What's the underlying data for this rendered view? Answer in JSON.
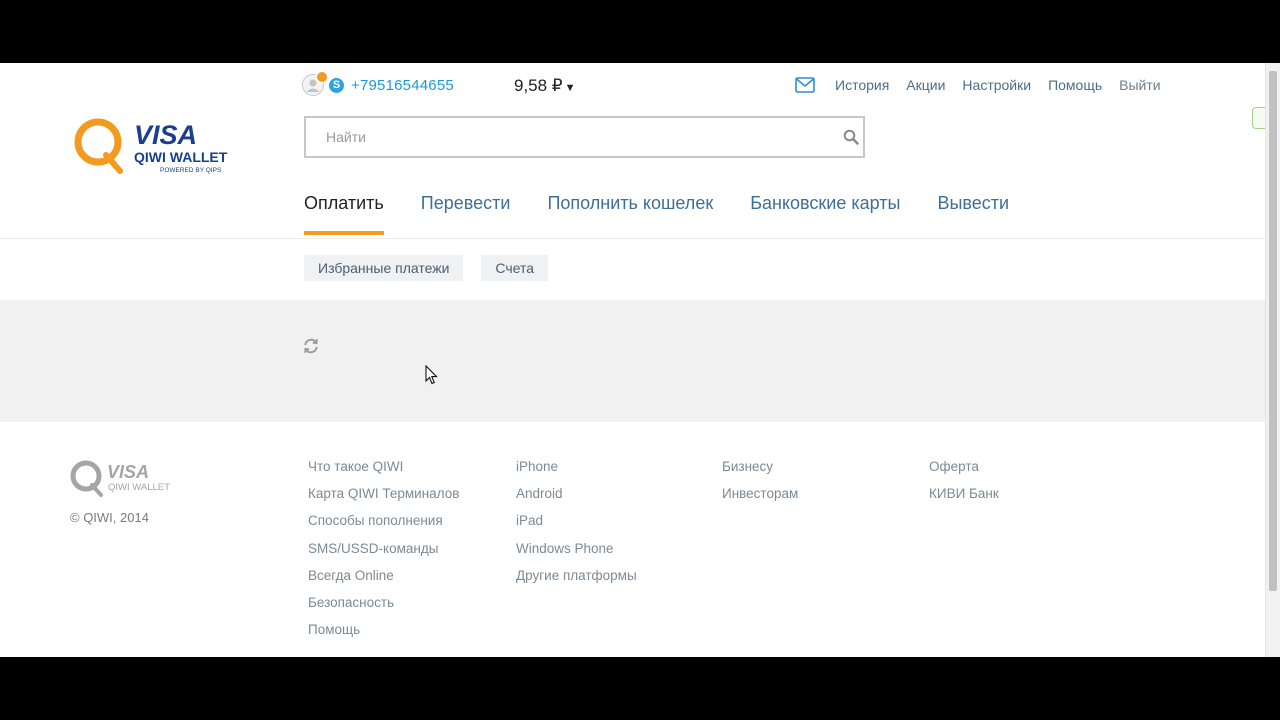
{
  "brand": {
    "logo_word": "VISA",
    "logo_sub": "QIWI WALLET",
    "logo_tag": "POWERED BY QIPS",
    "color_orange": "#f29b1f",
    "color_blue": "#1a3f8f"
  },
  "user": {
    "phone": "+79516544655",
    "balance": "9,58 ₽"
  },
  "top_nav": [
    "История",
    "Акции",
    "Настройки",
    "Помощь",
    "Выйти"
  ],
  "search": {
    "placeholder": "Найти"
  },
  "main_tabs": [
    "Оплатить",
    "Перевести",
    "Пополнить кошелек",
    "Банковские карты",
    "Вывести"
  ],
  "sub_tabs": [
    "Избранные платежи",
    "Счета"
  ],
  "footer": {
    "logo_word": "VISA",
    "logo_sub": "QIWI WALLET",
    "copyright": "© QIWI, 2014",
    "col1": [
      "Что такое QIWI",
      "Карта QIWI Терминалов",
      "Способы пополнения",
      "SMS/USSD-команды",
      "Всегда Online",
      "Безопасность",
      "Помощь"
    ],
    "col2": [
      "iPhone",
      "Android",
      "iPad",
      "Windows Phone",
      "Другие платформы"
    ],
    "col3": [
      "Бизнесу",
      "Инвесторам"
    ],
    "col4": [
      "Оферта",
      "КИВИ Банк"
    ]
  }
}
